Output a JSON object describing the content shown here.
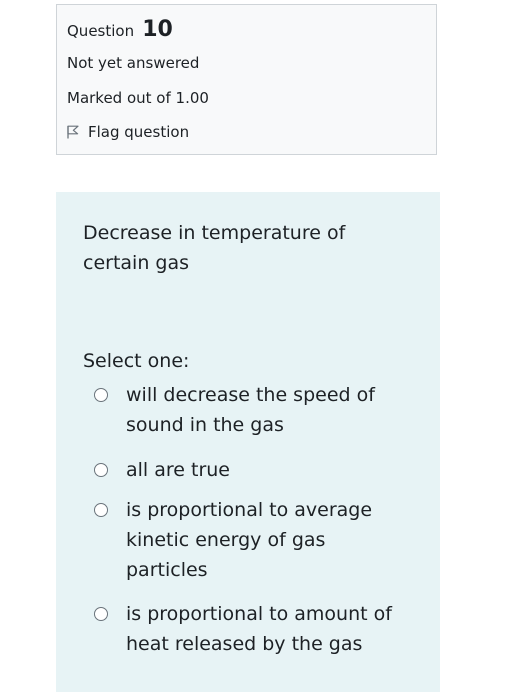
{
  "question_info": {
    "label": "Question",
    "number": "10",
    "state": "Not yet answered",
    "grade": "Marked out of 1.00",
    "flag_label": "Flag question"
  },
  "question": {
    "text": "Decrease in temperature of certain gas",
    "prompt": "Select one:",
    "options": [
      {
        "label": "will decrease the speed of sound in the gas",
        "selected": false
      },
      {
        "label": "all are true",
        "selected": false
      },
      {
        "label": "is proportional to average kinetic energy of gas particles",
        "selected": false
      },
      {
        "label": "is proportional to amount of heat released by the gas",
        "selected": false
      }
    ]
  },
  "colors": {
    "info_background": "#f8f9fa",
    "content_background": "#e7f3f5",
    "text": "#1d2125"
  },
  "icons": {
    "flag": "flag-icon",
    "radio": "radio-icon"
  }
}
